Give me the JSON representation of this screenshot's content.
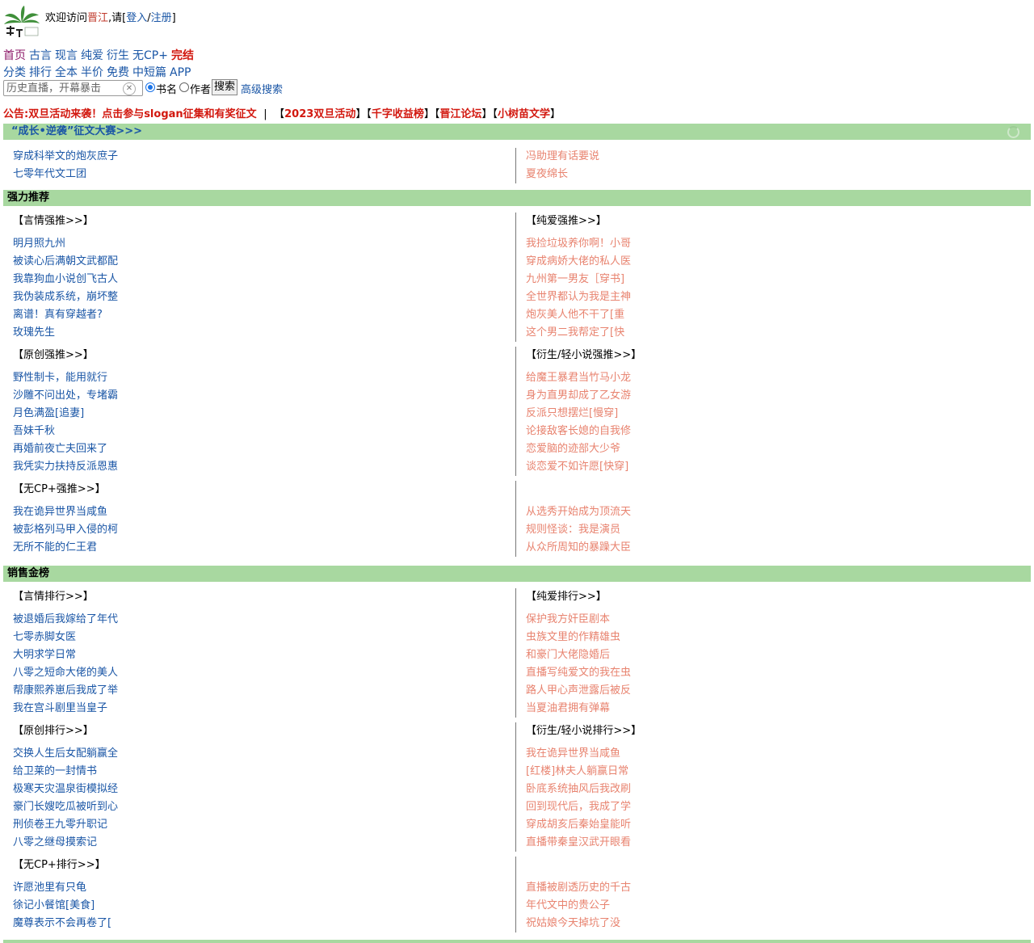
{
  "header": {
    "welcome_prefix": "欢迎访问",
    "site_name": "晋江",
    "welcome_mid": ",请[",
    "login": "登入",
    "slash": "/",
    "register": "注册",
    "welcome_end": "]"
  },
  "nav1": [
    {
      "label": "首页",
      "style": "active"
    },
    {
      "label": "古言",
      "style": ""
    },
    {
      "label": "现言",
      "style": ""
    },
    {
      "label": "纯爱",
      "style": ""
    },
    {
      "label": "衍生",
      "style": ""
    },
    {
      "label": "无CP+",
      "style": ""
    },
    {
      "label": "完结",
      "style": "bold"
    }
  ],
  "nav2": [
    "分类",
    "排行",
    "全本",
    "半价",
    "免费",
    "中短篇",
    "APP"
  ],
  "search": {
    "placeholder": "历史直播，开幕暴击",
    "option_title": "书名",
    "option_author": "作者",
    "button": "搜索",
    "advanced": "高级搜索"
  },
  "announce": {
    "main": "公告:双旦活动来袭！点击参与slogan征集和有奖征文",
    "sep": "|",
    "links": [
      "2023双旦活动",
      "千字收益榜",
      "晋江论坛",
      "小树苗文学"
    ]
  },
  "contest": {
    "title": "“成长•逆袭”征文大赛>>>",
    "left": [
      "穿成科举文的炮灰庶子",
      "七零年代文工团"
    ],
    "right": [
      "冯助理有话要说",
      "夏夜绵长"
    ]
  },
  "recommend": {
    "title": "强力推荐",
    "groups": [
      {
        "left_cat": "【言情强推>>】",
        "right_cat": "【纯爱强推>>】",
        "left": [
          "明月照九州",
          "被读心后满朝文武都配",
          "我靠狗血小说创飞古人",
          "我伪装成系统，崩坏整",
          "离谱！真有穿越者?",
          "玫瑰先生"
        ],
        "right": [
          "我捡垃圾养你啊！小哥",
          "穿成病娇大佬的私人医",
          "九州第一男友［穿书]",
          "全世界都认为我是主神",
          "炮灰美人他不干了[重",
          "这个男二我帮定了[快"
        ]
      },
      {
        "left_cat": "【原创强推>>】",
        "right_cat": "【衍生/轻小说强推>>】",
        "left": [
          "野性制卡，能用就行",
          "沙雕不问出处，专堵霸",
          "月色满盈[追妻]",
          "吾妹千秋",
          "再婚前夜亡夫回来了",
          "我凭实力扶持反派恩惠"
        ],
        "right": [
          "给魔王暴君当竹马小龙",
          "身为直男却成了乙女游",
          "反派只想摆烂[慢穿]",
          "论接敌客长媳的自我修",
          "恋爱脑的迹部大少爷",
          "谈恋爱不如许愿[快穿]"
        ]
      },
      {
        "left_cat": "【无CP+强推>>】",
        "right_cat": "",
        "left": [
          "我在诡异世界当咸鱼",
          "被彭格列马甲入侵的柯",
          "无所不能的仁王君"
        ],
        "right": [
          "从选秀开始成为顶流天",
          "规则怪谈：我是演员",
          "从众所周知的暴躁大臣"
        ]
      }
    ]
  },
  "sales": {
    "title": "销售金榜",
    "groups": [
      {
        "left_cat": "【言情排行>>】",
        "right_cat": "【纯爱排行>>】",
        "left": [
          "被退婚后我嫁给了年代",
          "七零赤脚女医",
          "大明求学日常",
          "八零之短命大佬的美人",
          "帮康熙养崽后我成了举",
          "我在宫斗剧里当皇子"
        ],
        "right": [
          "保护我方奸臣剧本",
          "虫族文里的作精雄虫",
          "和豪门大佬隐婚后",
          "直播写纯爱文的我在虫",
          "路人甲心声泄露后被反",
          "当夏油君拥有弹幕"
        ]
      },
      {
        "left_cat": "【原创排行>>】",
        "right_cat": "【衍生/轻小说排行>>】",
        "left": [
          "交换人生后女配躺赢全",
          "给卫莱的一封情书",
          "极寒天灾温泉街模拟经",
          "豪门长嫂吃瓜被听到心",
          "刑侦卷王九零升职记",
          "八零之继母摸索记"
        ],
        "right": [
          "我在诡异世界当咸鱼",
          "[红楼]林夫人躺赢日常",
          "卧底系统抽风后我改刷",
          "回到现代后，我成了学",
          "穿成胡亥后秦始皇能听",
          "直播带秦皇汉武开眼看"
        ]
      },
      {
        "left_cat": "【无CP+排行>>】",
        "right_cat": "",
        "left": [
          "许愿池里有只龟",
          "徐记小餐馆[美食]",
          "魔尊表示不会再卷了["
        ],
        "right": [
          "直播被剧透历史的千古",
          "年代文中的贵公子",
          "祝姑娘今天掉坑了没"
        ]
      }
    ]
  },
  "colors": {
    "band": "#a8d8a0",
    "link": "#1a56a6",
    "right_link": "#e8836f",
    "red": "#d2180f"
  },
  "icons": [
    "jinjiang-logo",
    "clear-icon",
    "loading-icon"
  ]
}
